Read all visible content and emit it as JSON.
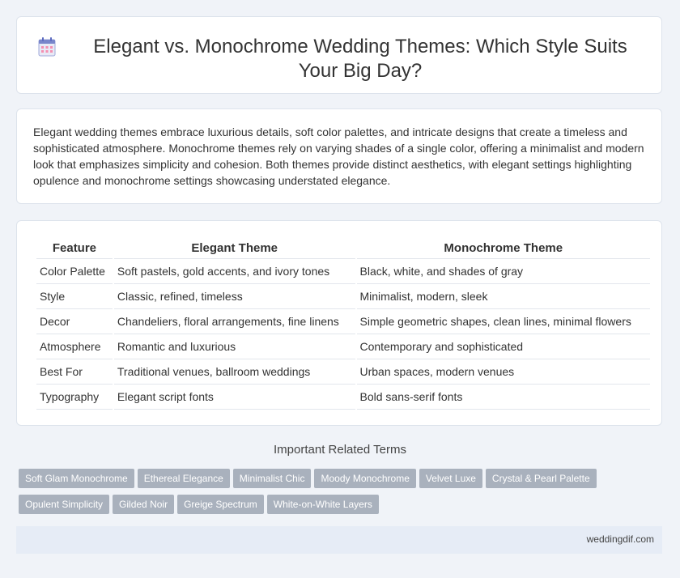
{
  "header": {
    "title": "Elegant vs. Monochrome Wedding Themes: Which Style Suits Your Big Day?",
    "icon": "calendar-icon"
  },
  "intro": {
    "text": "Elegant wedding themes embrace luxurious details, soft color palettes, and intricate designs that create a timeless and sophisticated atmosphere. Monochrome themes rely on varying shades of a single color, offering a minimalist and modern look that emphasizes simplicity and cohesion. Both themes provide distinct aesthetics, with elegant settings highlighting opulence and monochrome settings showcasing understated elegance."
  },
  "table": {
    "headers": [
      "Feature",
      "Elegant Theme",
      "Monochrome Theme"
    ],
    "rows": [
      [
        "Color Palette",
        "Soft pastels, gold accents, and ivory tones",
        "Black, white, and shades of gray"
      ],
      [
        "Style",
        "Classic, refined, timeless",
        "Minimalist, modern, sleek"
      ],
      [
        "Decor",
        "Chandeliers, floral arrangements, fine linens",
        "Simple geometric shapes, clean lines, minimal flowers"
      ],
      [
        "Atmosphere",
        "Romantic and luxurious",
        "Contemporary and sophisticated"
      ],
      [
        "Best For",
        "Traditional venues, ballroom weddings",
        "Urban spaces, modern venues"
      ],
      [
        "Typography",
        "Elegant script fonts",
        "Bold sans-serif fonts"
      ]
    ]
  },
  "terms": {
    "title": "Important Related Terms",
    "items": [
      "Soft Glam Monochrome",
      "Ethereal Elegance",
      "Minimalist Chic",
      "Moody Monochrome",
      "Velvet Luxe",
      "Crystal & Pearl Palette",
      "Opulent Simplicity",
      "Gilded Noir",
      "Greige Spectrum",
      "White-on-White Layers"
    ]
  },
  "footer": {
    "site": "weddingdif.com"
  },
  "colors": {
    "tag_bg": "#a9b1bd",
    "page_bg": "#f0f3f8",
    "footer_bg": "#e6ecf6"
  }
}
